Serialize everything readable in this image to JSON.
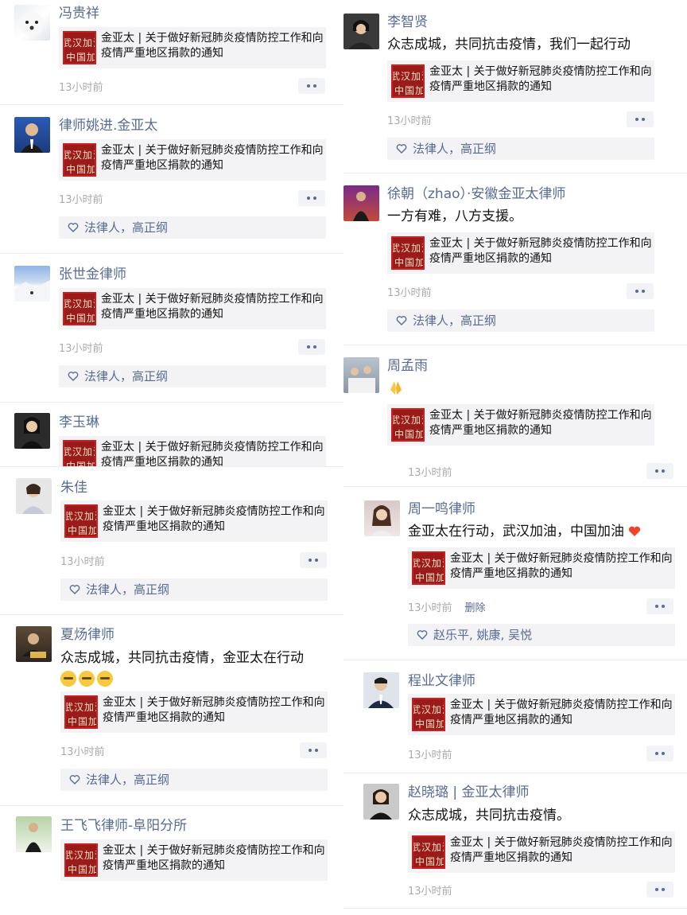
{
  "link_title": "金亚太 | 关于做好新冠肺炎疫情防控工作和向疫情严重地区捐款的通知",
  "thumb_row1": "武汉加油",
  "thumb_row2": "中国加油",
  "more_icon": "more-dots-icon",
  "like_icon": "heart-outline-icon",
  "colors": {
    "name": "#576b95",
    "time": "#aaaaaa",
    "thumb_bg": "#9b1a1a",
    "panel": "#f3f3f5"
  },
  "left_posts": [
    {
      "name": "冯贵祥",
      "time": "13小时前"
    },
    {
      "name": "律师姚进.金亚太",
      "time": "13小时前",
      "likes": "法律人，高正纲"
    },
    {
      "name": "张世金律师",
      "time": "13小时前",
      "likes": "法律人，高正纲"
    },
    {
      "name": "李玉琳"
    },
    {
      "name": "朱佳",
      "time": "13小时前",
      "likes": "法律人，高正纲"
    },
    {
      "name": "夏炀律师",
      "text": "众志成城，共同抗击疫情，金亚太在行动",
      "emoji": "🤕🤕🤕",
      "time": "13小时前",
      "likes": "法律人，高正纲"
    },
    {
      "name": "王飞飞律师-阜阳分所"
    }
  ],
  "right_posts": [
    {
      "name": "李智贤",
      "text": "众志成城，共同抗击疫情，我们一起行动",
      "time": "13小时前",
      "likes": "法律人，高正纲"
    },
    {
      "name": "徐朝（zhao）·安徽金亚太律师",
      "text": "一方有难，八方支援。",
      "time": "13小时前",
      "likes": "法律人，高正纲"
    },
    {
      "name": "周孟雨",
      "emoji": "🙏"
    },
    {
      "time": "13小时前"
    },
    {
      "name": "周一鸣律师",
      "text": "金亚太在行动，武汉加油，中国加油",
      "time": "13小时前",
      "delete": "删除",
      "likes": "赵乐平, 姚康, 吴悦"
    },
    {
      "name": "程业文律师",
      "time": "13小时前"
    },
    {
      "name": "赵晓璐 | 金亚太律师",
      "text": "众志成城，共同抗击疫情。",
      "time": "13小时前"
    }
  ]
}
